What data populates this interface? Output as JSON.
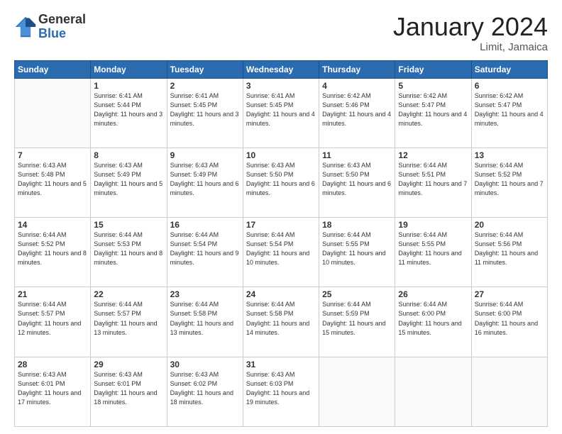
{
  "logo": {
    "general": "General",
    "blue": "Blue"
  },
  "header": {
    "month": "January 2024",
    "location": "Limit, Jamaica"
  },
  "weekdays": [
    "Sunday",
    "Monday",
    "Tuesday",
    "Wednesday",
    "Thursday",
    "Friday",
    "Saturday"
  ],
  "weeks": [
    [
      {
        "day": "",
        "empty": true
      },
      {
        "day": "1",
        "sunrise": "Sunrise: 6:41 AM",
        "sunset": "Sunset: 5:44 PM",
        "daylight": "Daylight: 11 hours and 3 minutes."
      },
      {
        "day": "2",
        "sunrise": "Sunrise: 6:41 AM",
        "sunset": "Sunset: 5:45 PM",
        "daylight": "Daylight: 11 hours and 3 minutes."
      },
      {
        "day": "3",
        "sunrise": "Sunrise: 6:41 AM",
        "sunset": "Sunset: 5:45 PM",
        "daylight": "Daylight: 11 hours and 4 minutes."
      },
      {
        "day": "4",
        "sunrise": "Sunrise: 6:42 AM",
        "sunset": "Sunset: 5:46 PM",
        "daylight": "Daylight: 11 hours and 4 minutes."
      },
      {
        "day": "5",
        "sunrise": "Sunrise: 6:42 AM",
        "sunset": "Sunset: 5:47 PM",
        "daylight": "Daylight: 11 hours and 4 minutes."
      },
      {
        "day": "6",
        "sunrise": "Sunrise: 6:42 AM",
        "sunset": "Sunset: 5:47 PM",
        "daylight": "Daylight: 11 hours and 4 minutes."
      }
    ],
    [
      {
        "day": "7",
        "sunrise": "Sunrise: 6:43 AM",
        "sunset": "Sunset: 5:48 PM",
        "daylight": "Daylight: 11 hours and 5 minutes."
      },
      {
        "day": "8",
        "sunrise": "Sunrise: 6:43 AM",
        "sunset": "Sunset: 5:49 PM",
        "daylight": "Daylight: 11 hours and 5 minutes."
      },
      {
        "day": "9",
        "sunrise": "Sunrise: 6:43 AM",
        "sunset": "Sunset: 5:49 PM",
        "daylight": "Daylight: 11 hours and 6 minutes."
      },
      {
        "day": "10",
        "sunrise": "Sunrise: 6:43 AM",
        "sunset": "Sunset: 5:50 PM",
        "daylight": "Daylight: 11 hours and 6 minutes."
      },
      {
        "day": "11",
        "sunrise": "Sunrise: 6:43 AM",
        "sunset": "Sunset: 5:50 PM",
        "daylight": "Daylight: 11 hours and 6 minutes."
      },
      {
        "day": "12",
        "sunrise": "Sunrise: 6:44 AM",
        "sunset": "Sunset: 5:51 PM",
        "daylight": "Daylight: 11 hours and 7 minutes."
      },
      {
        "day": "13",
        "sunrise": "Sunrise: 6:44 AM",
        "sunset": "Sunset: 5:52 PM",
        "daylight": "Daylight: 11 hours and 7 minutes."
      }
    ],
    [
      {
        "day": "14",
        "sunrise": "Sunrise: 6:44 AM",
        "sunset": "Sunset: 5:52 PM",
        "daylight": "Daylight: 11 hours and 8 minutes."
      },
      {
        "day": "15",
        "sunrise": "Sunrise: 6:44 AM",
        "sunset": "Sunset: 5:53 PM",
        "daylight": "Daylight: 11 hours and 8 minutes."
      },
      {
        "day": "16",
        "sunrise": "Sunrise: 6:44 AM",
        "sunset": "Sunset: 5:54 PM",
        "daylight": "Daylight: 11 hours and 9 minutes."
      },
      {
        "day": "17",
        "sunrise": "Sunrise: 6:44 AM",
        "sunset": "Sunset: 5:54 PM",
        "daylight": "Daylight: 11 hours and 10 minutes."
      },
      {
        "day": "18",
        "sunrise": "Sunrise: 6:44 AM",
        "sunset": "Sunset: 5:55 PM",
        "daylight": "Daylight: 11 hours and 10 minutes."
      },
      {
        "day": "19",
        "sunrise": "Sunrise: 6:44 AM",
        "sunset": "Sunset: 5:55 PM",
        "daylight": "Daylight: 11 hours and 11 minutes."
      },
      {
        "day": "20",
        "sunrise": "Sunrise: 6:44 AM",
        "sunset": "Sunset: 5:56 PM",
        "daylight": "Daylight: 11 hours and 11 minutes."
      }
    ],
    [
      {
        "day": "21",
        "sunrise": "Sunrise: 6:44 AM",
        "sunset": "Sunset: 5:57 PM",
        "daylight": "Daylight: 11 hours and 12 minutes."
      },
      {
        "day": "22",
        "sunrise": "Sunrise: 6:44 AM",
        "sunset": "Sunset: 5:57 PM",
        "daylight": "Daylight: 11 hours and 13 minutes."
      },
      {
        "day": "23",
        "sunrise": "Sunrise: 6:44 AM",
        "sunset": "Sunset: 5:58 PM",
        "daylight": "Daylight: 11 hours and 13 minutes."
      },
      {
        "day": "24",
        "sunrise": "Sunrise: 6:44 AM",
        "sunset": "Sunset: 5:58 PM",
        "daylight": "Daylight: 11 hours and 14 minutes."
      },
      {
        "day": "25",
        "sunrise": "Sunrise: 6:44 AM",
        "sunset": "Sunset: 5:59 PM",
        "daylight": "Daylight: 11 hours and 15 minutes."
      },
      {
        "day": "26",
        "sunrise": "Sunrise: 6:44 AM",
        "sunset": "Sunset: 6:00 PM",
        "daylight": "Daylight: 11 hours and 15 minutes."
      },
      {
        "day": "27",
        "sunrise": "Sunrise: 6:44 AM",
        "sunset": "Sunset: 6:00 PM",
        "daylight": "Daylight: 11 hours and 16 minutes."
      }
    ],
    [
      {
        "day": "28",
        "sunrise": "Sunrise: 6:43 AM",
        "sunset": "Sunset: 6:01 PM",
        "daylight": "Daylight: 11 hours and 17 minutes."
      },
      {
        "day": "29",
        "sunrise": "Sunrise: 6:43 AM",
        "sunset": "Sunset: 6:01 PM",
        "daylight": "Daylight: 11 hours and 18 minutes."
      },
      {
        "day": "30",
        "sunrise": "Sunrise: 6:43 AM",
        "sunset": "Sunset: 6:02 PM",
        "daylight": "Daylight: 11 hours and 18 minutes."
      },
      {
        "day": "31",
        "sunrise": "Sunrise: 6:43 AM",
        "sunset": "Sunset: 6:03 PM",
        "daylight": "Daylight: 11 hours and 19 minutes."
      },
      {
        "day": "",
        "empty": true
      },
      {
        "day": "",
        "empty": true
      },
      {
        "day": "",
        "empty": true
      }
    ]
  ]
}
